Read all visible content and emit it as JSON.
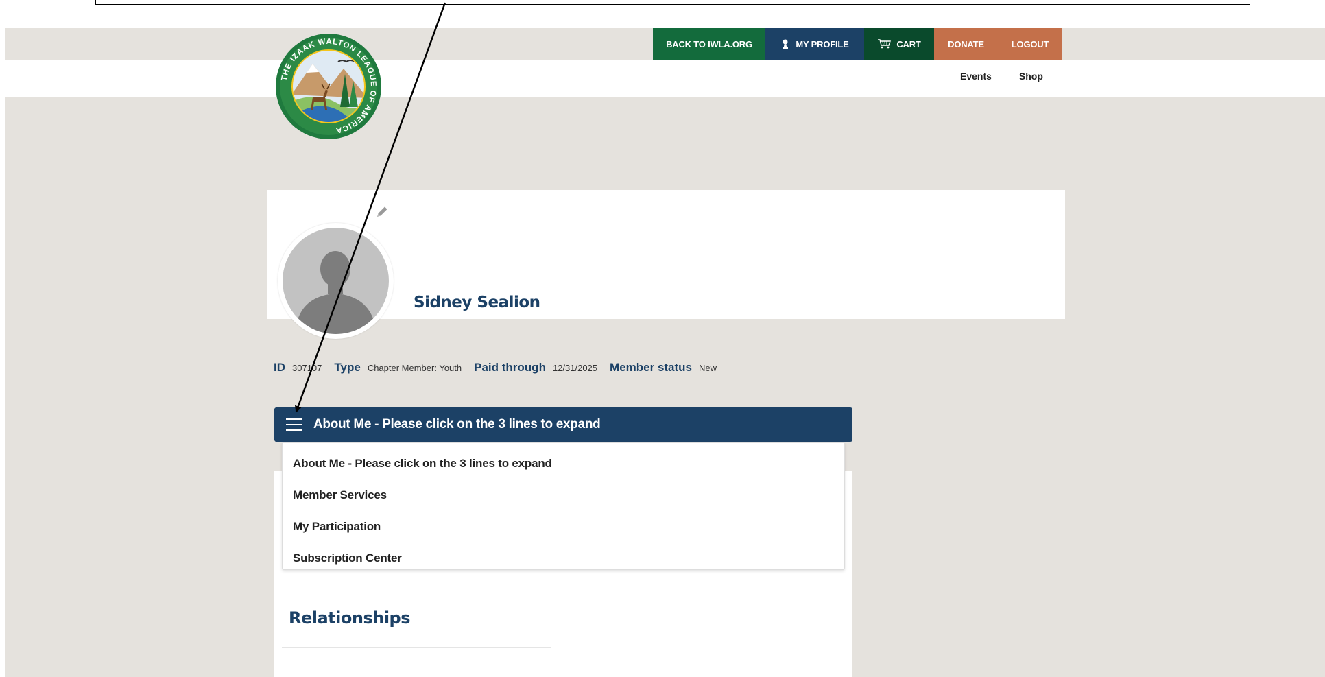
{
  "topnav": {
    "back_label": "BACK TO IWLA.ORG",
    "profile_label": "MY PROFILE",
    "cart_label": "CART",
    "donate_label": "DONATE",
    "logout_label": "LOGOUT",
    "icons": [
      "user-icon",
      "cart-icon"
    ],
    "colors": {
      "back": "#136b3c",
      "profile": "#1c4166",
      "cart": "#0a4a2c",
      "donate": "#c4704a"
    }
  },
  "subnav": {
    "events": "Events",
    "shop": "Shop"
  },
  "logo": {
    "ring_text": "THE IZAAK WALTON LEAGUE OF AMERICA"
  },
  "profile": {
    "name": "Sidney Sealion",
    "id_label": "ID",
    "id_value": "307107",
    "type_label": "Type",
    "type_value": "Chapter Member: Youth",
    "paid_label": "Paid through",
    "paid_value": "12/31/2025",
    "status_label": "Member status",
    "status_value": "New"
  },
  "accordion": {
    "title": "About Me - Please click on the 3 lines to expand",
    "items": [
      "About Me - Please click on the 3 lines to expand",
      "Member Services",
      "My Participation",
      "Subscription Center"
    ]
  },
  "relationships": {
    "title": "Relationships"
  },
  "theme": {
    "primary": "#1c4166",
    "background": "#e5e2dd"
  }
}
